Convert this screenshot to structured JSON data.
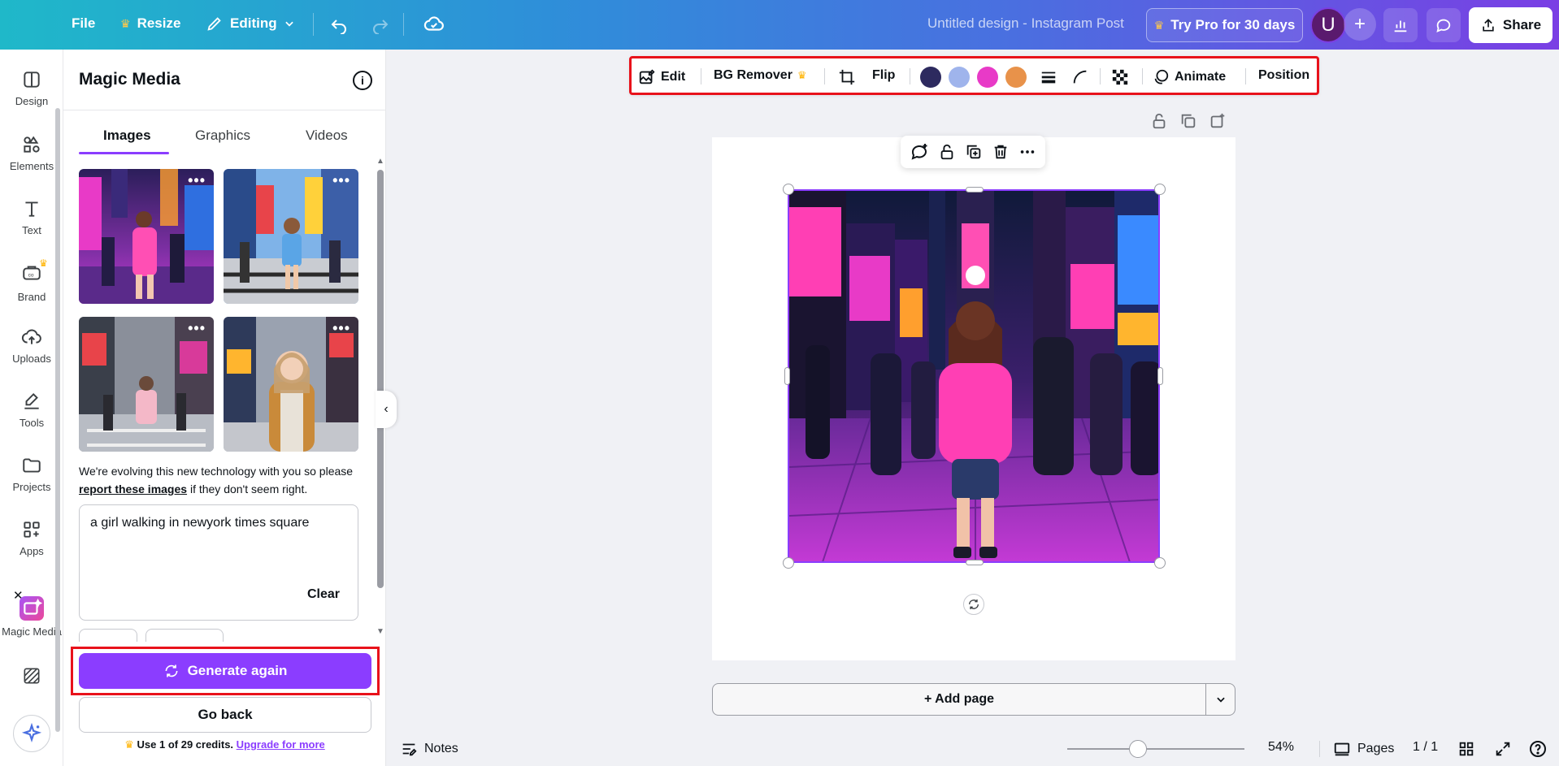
{
  "topbar": {
    "file": "File",
    "resize": "Resize",
    "editing": "Editing",
    "design_title": "Untitled design - Instagram Post",
    "try_pro": "Try Pro for 30 days",
    "avatar_initial": "U",
    "share": "Share"
  },
  "rail": {
    "items": [
      "Design",
      "Elements",
      "Text",
      "Brand",
      "Uploads",
      "Tools",
      "Projects",
      "Apps",
      "Magic Media"
    ]
  },
  "panel": {
    "title": "Magic Media",
    "tabs": [
      "Images",
      "Graphics",
      "Videos"
    ],
    "active_tab": "Images",
    "disclaimer_pre": "We're evolving this new technology with you so please ",
    "disclaimer_link": "report these images",
    "disclaimer_post": " if they don't seem right.",
    "prompt": "a girl walking in newyork times square",
    "clear": "Clear",
    "generate_again": "Generate again",
    "go_back": "Go back",
    "credits_pre": "Use 1 of 29 credits. ",
    "credits_link": "Upgrade for more"
  },
  "context_toolbar": {
    "edit": "Edit",
    "bg_remover": "BG Remover",
    "flip": "Flip",
    "animate": "Animate",
    "position": "Position",
    "swatches": [
      "#2d2a5f",
      "#9fb4ec",
      "#e83ac7",
      "#e8924a"
    ]
  },
  "canvas": {
    "add_page": "+ Add page"
  },
  "bottombar": {
    "notes": "Notes",
    "zoom": "54%",
    "zoom_fraction": 0.4,
    "pages": "Pages",
    "page_count": "1 / 1"
  },
  "colors": {
    "accent": "#8b3dff",
    "highlight": "#e8121b"
  }
}
